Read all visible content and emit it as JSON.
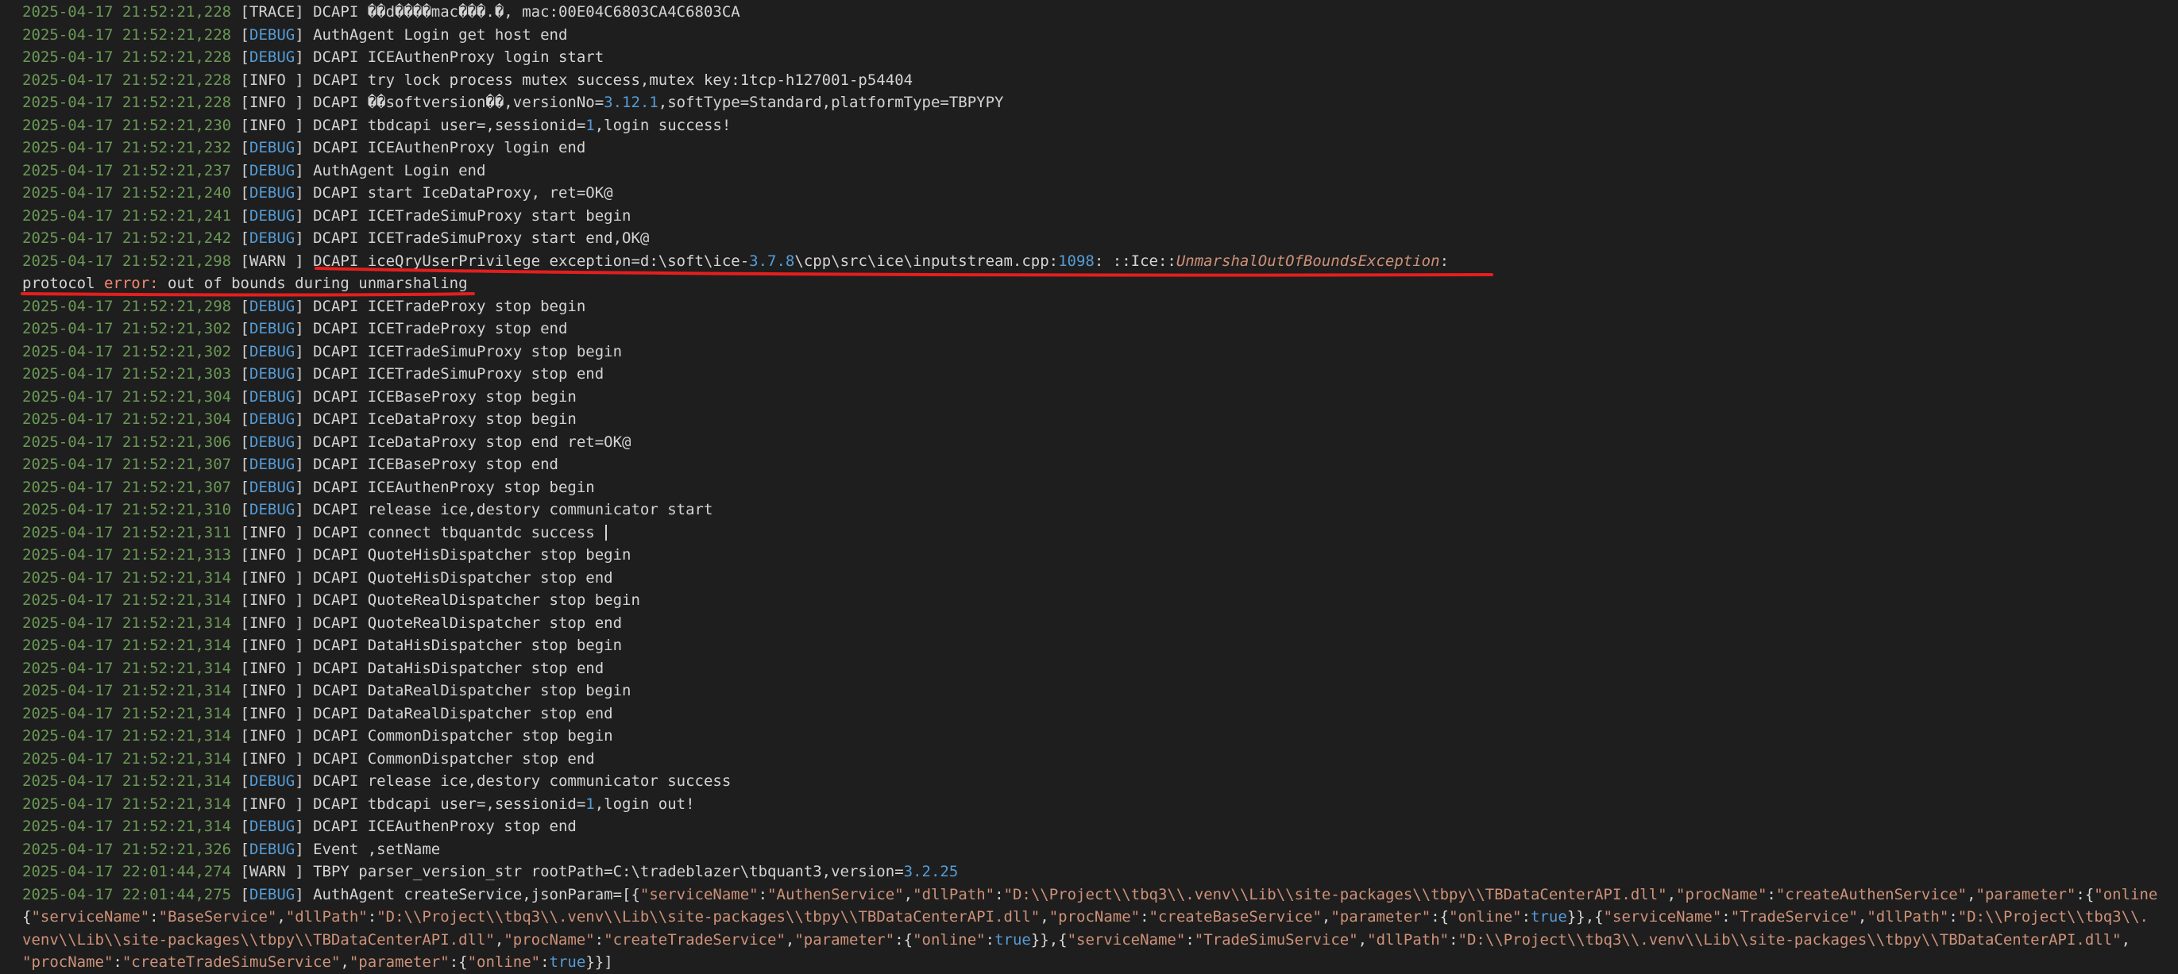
{
  "colors": {
    "background": "#1e1e1e",
    "text": "#d4d4d4",
    "timestamp": "#6a9955",
    "debug": "#569cd6",
    "number": "#569cd6",
    "string": "#ce9178",
    "error": "#f48771",
    "annotation": "#e51e1e"
  },
  "log_lines": [
    {
      "ts": "2025-04-17 21:52:21,228",
      "level": "TRACE",
      "msg": [
        {
          "t": "DCAPI ��d����mac���.�, mac:00E04C6803CA4C6803CA"
        }
      ]
    },
    {
      "ts": "2025-04-17 21:52:21,228",
      "level": "DEBUG",
      "msg": [
        {
          "t": "AuthAgent Login get host end"
        }
      ]
    },
    {
      "ts": "2025-04-17 21:52:21,228",
      "level": "DEBUG",
      "msg": [
        {
          "t": "DCAPI ICEAuthenProxy login start"
        }
      ]
    },
    {
      "ts": "2025-04-17 21:52:21,228",
      "level": "INFO ",
      "msg": [
        {
          "t": "DCAPI try lock process mutex success,mutex key:1tcp-h127001-p54404"
        }
      ]
    },
    {
      "ts": "2025-04-17 21:52:21,228",
      "level": "INFO ",
      "msg": [
        {
          "t": "DCAPI ��softversion��,versionNo="
        },
        {
          "t": "3.12.1",
          "c": "num"
        },
        {
          "t": ",softType=Standard,platformType=TBPYPY"
        }
      ]
    },
    {
      "ts": "2025-04-17 21:52:21,230",
      "level": "INFO ",
      "msg": [
        {
          "t": "DCAPI tbdcapi user=,sessionid="
        },
        {
          "t": "1",
          "c": "num"
        },
        {
          "t": ",login success!"
        }
      ]
    },
    {
      "ts": "2025-04-17 21:52:21,232",
      "level": "DEBUG",
      "msg": [
        {
          "t": "DCAPI ICEAuthenProxy login end"
        }
      ]
    },
    {
      "ts": "2025-04-17 21:52:21,237",
      "level": "DEBUG",
      "msg": [
        {
          "t": "AuthAgent Login end"
        }
      ]
    },
    {
      "ts": "2025-04-17 21:52:21,240",
      "level": "DEBUG",
      "msg": [
        {
          "t": "DCAPI start IceDataProxy, ret=OK@"
        }
      ]
    },
    {
      "ts": "2025-04-17 21:52:21,241",
      "level": "DEBUG",
      "msg": [
        {
          "t": "DCAPI ICETradeSimuProxy start begin"
        }
      ]
    },
    {
      "ts": "2025-04-17 21:52:21,242",
      "level": "DEBUG",
      "msg": [
        {
          "t": "DCAPI ICETradeSimuProxy start end,OK@"
        }
      ]
    },
    {
      "ts": "2025-04-17 21:52:21,298",
      "level": "WARN ",
      "msg": [
        {
          "t": "DCAPI iceQryUserPrivilege exception=d:\\soft\\ice-"
        },
        {
          "t": "3.7.8",
          "c": "num"
        },
        {
          "t": "\\cpp\\src\\ice\\inputstream.cpp:"
        },
        {
          "t": "1098",
          "c": "num"
        },
        {
          "t": ": ::Ice::"
        },
        {
          "t": "UnmarshalOutOfBoundsException",
          "c": "exc"
        },
        {
          "t": ":"
        }
      ]
    },
    {
      "ts": "",
      "level": "",
      "msg": [
        {
          "t": "protocol "
        },
        {
          "t": "error:",
          "c": "err"
        },
        {
          "t": " out of bounds during unmarshaling"
        }
      ]
    },
    {
      "ts": "2025-04-17 21:52:21,298",
      "level": "DEBUG",
      "msg": [
        {
          "t": "DCAPI ICETradeProxy stop begin"
        }
      ]
    },
    {
      "ts": "2025-04-17 21:52:21,302",
      "level": "DEBUG",
      "msg": [
        {
          "t": "DCAPI ICETradeProxy stop end"
        }
      ]
    },
    {
      "ts": "2025-04-17 21:52:21,302",
      "level": "DEBUG",
      "msg": [
        {
          "t": "DCAPI ICETradeSimuProxy stop begin"
        }
      ]
    },
    {
      "ts": "2025-04-17 21:52:21,303",
      "level": "DEBUG",
      "msg": [
        {
          "t": "DCAPI ICETradeSimuProxy stop end"
        }
      ]
    },
    {
      "ts": "2025-04-17 21:52:21,304",
      "level": "DEBUG",
      "msg": [
        {
          "t": "DCAPI ICEBaseProxy stop begin"
        }
      ]
    },
    {
      "ts": "2025-04-17 21:52:21,304",
      "level": "DEBUG",
      "msg": [
        {
          "t": "DCAPI IceDataProxy stop begin"
        }
      ]
    },
    {
      "ts": "2025-04-17 21:52:21,306",
      "level": "DEBUG",
      "msg": [
        {
          "t": "DCAPI IceDataProxy stop end ret=OK@"
        }
      ]
    },
    {
      "ts": "2025-04-17 21:52:21,307",
      "level": "DEBUG",
      "msg": [
        {
          "t": "DCAPI ICEBaseProxy stop end"
        }
      ]
    },
    {
      "ts": "2025-04-17 21:52:21,307",
      "level": "DEBUG",
      "msg": [
        {
          "t": "DCAPI ICEAuthenProxy stop begin"
        }
      ]
    },
    {
      "ts": "2025-04-17 21:52:21,310",
      "level": "DEBUG",
      "msg": [
        {
          "t": "DCAPI release ice,destory communicator start"
        }
      ]
    },
    {
      "ts": "2025-04-17 21:52:21,311",
      "level": "INFO ",
      "msg": [
        {
          "t": "DCAPI connect tbquantdc success "
        }
      ],
      "cursor": true
    },
    {
      "ts": "2025-04-17 21:52:21,313",
      "level": "INFO ",
      "msg": [
        {
          "t": "DCAPI QuoteHisDispatcher stop begin"
        }
      ]
    },
    {
      "ts": "2025-04-17 21:52:21,314",
      "level": "INFO ",
      "msg": [
        {
          "t": "DCAPI QuoteHisDispatcher stop end"
        }
      ]
    },
    {
      "ts": "2025-04-17 21:52:21,314",
      "level": "INFO ",
      "msg": [
        {
          "t": "DCAPI QuoteRealDispatcher stop begin"
        }
      ]
    },
    {
      "ts": "2025-04-17 21:52:21,314",
      "level": "INFO ",
      "msg": [
        {
          "t": "DCAPI QuoteRealDispatcher stop end"
        }
      ]
    },
    {
      "ts": "2025-04-17 21:52:21,314",
      "level": "INFO ",
      "msg": [
        {
          "t": "DCAPI DataHisDispatcher stop begin"
        }
      ]
    },
    {
      "ts": "2025-04-17 21:52:21,314",
      "level": "INFO ",
      "msg": [
        {
          "t": "DCAPI DataHisDispatcher stop end"
        }
      ]
    },
    {
      "ts": "2025-04-17 21:52:21,314",
      "level": "INFO ",
      "msg": [
        {
          "t": "DCAPI DataRealDispatcher stop begin"
        }
      ]
    },
    {
      "ts": "2025-04-17 21:52:21,314",
      "level": "INFO ",
      "msg": [
        {
          "t": "DCAPI DataRealDispatcher stop end"
        }
      ]
    },
    {
      "ts": "2025-04-17 21:52:21,314",
      "level": "INFO ",
      "msg": [
        {
          "t": "DCAPI CommonDispatcher stop begin"
        }
      ]
    },
    {
      "ts": "2025-04-17 21:52:21,314",
      "level": "INFO ",
      "msg": [
        {
          "t": "DCAPI CommonDispatcher stop end"
        }
      ]
    },
    {
      "ts": "2025-04-17 21:52:21,314",
      "level": "DEBUG",
      "msg": [
        {
          "t": "DCAPI release ice,destory communicator success"
        }
      ]
    },
    {
      "ts": "2025-04-17 21:52:21,314",
      "level": "INFO ",
      "msg": [
        {
          "t": "DCAPI tbdcapi user=,sessionid="
        },
        {
          "t": "1",
          "c": "num"
        },
        {
          "t": ",login out!"
        }
      ]
    },
    {
      "ts": "2025-04-17 21:52:21,314",
      "level": "DEBUG",
      "msg": [
        {
          "t": "DCAPI ICEAuthenProxy stop end"
        }
      ]
    },
    {
      "ts": "2025-04-17 21:52:21,326",
      "level": "DEBUG",
      "msg": [
        {
          "t": "Event ,setName"
        }
      ]
    },
    {
      "ts": "2025-04-17 22:01:44,274",
      "level": "WARN ",
      "msg": [
        {
          "t": "TBPY parser_version_str rootPath=C:\\tradeblazer\\tbquant3,version="
        },
        {
          "t": "3.2.25",
          "c": "num"
        }
      ]
    },
    {
      "ts": "2025-04-17 22:01:44,275",
      "level": "DEBUG",
      "msg": [
        {
          "t": "AuthAgent createService,jsonParam=[{"
        },
        {
          "t": "\"serviceName\"",
          "c": "str"
        },
        {
          "t": ":"
        },
        {
          "t": "\"AuthenService\"",
          "c": "str"
        },
        {
          "t": ","
        },
        {
          "t": "\"dllPath\"",
          "c": "str"
        },
        {
          "t": ":"
        },
        {
          "t": "\"D:\\\\Project\\\\tbq3\\\\.venv\\\\Lib\\\\site-packages\\\\tbpy\\\\TBDataCenterAPI.dll\"",
          "c": "str"
        },
        {
          "t": ","
        },
        {
          "t": "\"procName\"",
          "c": "str"
        },
        {
          "t": ":"
        },
        {
          "t": "\"createAuthenService\"",
          "c": "str"
        },
        {
          "t": ","
        },
        {
          "t": "\"parameter\"",
          "c": "str"
        },
        {
          "t": ":{"
        },
        {
          "t": "\"online",
          "c": "str"
        }
      ]
    },
    {
      "ts": "",
      "level": "",
      "msg": [
        {
          "t": "{"
        },
        {
          "t": "\"serviceName\"",
          "c": "str"
        },
        {
          "t": ":"
        },
        {
          "t": "\"BaseService\"",
          "c": "str"
        },
        {
          "t": ","
        },
        {
          "t": "\"dllPath\"",
          "c": "str"
        },
        {
          "t": ":"
        },
        {
          "t": "\"D:\\\\Project\\\\tbq3\\\\.venv\\\\Lib\\\\site-packages\\\\tbpy\\\\TBDataCenterAPI.dll\"",
          "c": "str"
        },
        {
          "t": ","
        },
        {
          "t": "\"procName\"",
          "c": "str"
        },
        {
          "t": ":"
        },
        {
          "t": "\"createBaseService\"",
          "c": "str"
        },
        {
          "t": ","
        },
        {
          "t": "\"parameter\"",
          "c": "str"
        },
        {
          "t": ":{"
        },
        {
          "t": "\"online\"",
          "c": "str"
        },
        {
          "t": ":"
        },
        {
          "t": "true",
          "c": "num"
        },
        {
          "t": "}},{"
        },
        {
          "t": "\"serviceName\"",
          "c": "str"
        },
        {
          "t": ":"
        },
        {
          "t": "\"TradeService\"",
          "c": "str"
        },
        {
          "t": ","
        },
        {
          "t": "\"dllPath\"",
          "c": "str"
        },
        {
          "t": ":"
        },
        {
          "t": "\"D:\\\\Project\\\\tbq3\\\\.",
          "c": "str"
        }
      ]
    },
    {
      "ts": "",
      "level": "",
      "msg": [
        {
          "t": "venv\\\\Lib\\\\site-packages\\\\tbpy\\\\TBDataCenterAPI.dll\"",
          "c": "str"
        },
        {
          "t": ","
        },
        {
          "t": "\"procName\"",
          "c": "str"
        },
        {
          "t": ":"
        },
        {
          "t": "\"createTradeService\"",
          "c": "str"
        },
        {
          "t": ","
        },
        {
          "t": "\"parameter\"",
          "c": "str"
        },
        {
          "t": ":{"
        },
        {
          "t": "\"online\"",
          "c": "str"
        },
        {
          "t": ":"
        },
        {
          "t": "true",
          "c": "num"
        },
        {
          "t": "}},{"
        },
        {
          "t": "\"serviceName\"",
          "c": "str"
        },
        {
          "t": ":"
        },
        {
          "t": "\"TradeSimuService\"",
          "c": "str"
        },
        {
          "t": ","
        },
        {
          "t": "\"dllPath\"",
          "c": "str"
        },
        {
          "t": ":"
        },
        {
          "t": "\"D:\\\\Project\\\\tbq3\\\\.venv\\\\Lib\\\\site-packages\\\\tbpy\\\\TBDataCenterAPI.dll\"",
          "c": "str"
        },
        {
          "t": ","
        }
      ]
    },
    {
      "ts": "",
      "level": "",
      "msg": [
        {
          "t": "\"procName\"",
          "c": "str"
        },
        {
          "t": ":"
        },
        {
          "t": "\"createTradeSimuService\"",
          "c": "str"
        },
        {
          "t": ","
        },
        {
          "t": "\"parameter\"",
          "c": "str"
        },
        {
          "t": ":{"
        },
        {
          "t": "\"online\"",
          "c": "str"
        },
        {
          "t": ":"
        },
        {
          "t": "true",
          "c": "num"
        },
        {
          "t": "}}]"
        }
      ]
    }
  ]
}
